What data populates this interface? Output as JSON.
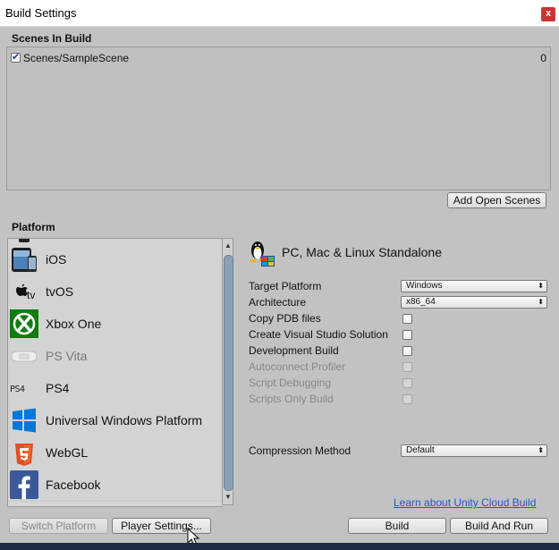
{
  "window": {
    "title": "Build Settings",
    "close_glyph": "x"
  },
  "scenes": {
    "label": "Scenes In Build",
    "items": [
      {
        "name": "Scenes/SampleScene",
        "index": "0",
        "checked": true
      }
    ],
    "add_open_scenes_label": "Add Open Scenes"
  },
  "platform": {
    "label": "Platform",
    "items": [
      {
        "label": "iOS",
        "icon": "ipad-icon"
      },
      {
        "label": "tvOS",
        "icon": "apple-tv-icon"
      },
      {
        "label": "Xbox One",
        "icon": "xbox-icon"
      },
      {
        "label": "PS Vita",
        "icon": "ps-vita-icon"
      },
      {
        "label": "PS4",
        "icon": "ps4-icon"
      },
      {
        "label": "Universal Windows Platform",
        "icon": "windows-icon"
      },
      {
        "label": "WebGL",
        "icon": "html5-icon"
      },
      {
        "label": "Facebook",
        "icon": "facebook-icon"
      }
    ]
  },
  "details": {
    "title": "PC, Mac & Linux Standalone",
    "target_platform": {
      "label": "Target Platform",
      "value": "Windows"
    },
    "architecture": {
      "label": "Architecture",
      "value": "x86_64"
    },
    "copy_pdb": {
      "label": "Copy PDB files",
      "checked": false
    },
    "create_vs": {
      "label": "Create Visual Studio Solution",
      "checked": false
    },
    "dev_build": {
      "label": "Development Build",
      "checked": false
    },
    "autoconnect": {
      "label": "Autoconnect Profiler",
      "checked": false,
      "disabled": true
    },
    "script_debugging": {
      "label": "Script Debugging",
      "checked": false,
      "disabled": true
    },
    "scripts_only": {
      "label": "Scripts Only Build",
      "checked": false,
      "disabled": true
    },
    "compression": {
      "label": "Compression Method",
      "value": "Default"
    }
  },
  "cloud_build_link": "Learn about Unity Cloud Build",
  "buttons": {
    "switch_platform": "Switch Platform",
    "player_settings": "Player Settings...",
    "build": "Build",
    "build_and_run": "Build And Run"
  },
  "colors": {
    "accent": "#1a5ec5",
    "scroll_thumb": "#8aa0b5",
    "xbox_green": "#107c10",
    "windows_blue": "#0078d7",
    "html5_orange": "#e44d26",
    "facebook_blue": "#3b5998"
  }
}
